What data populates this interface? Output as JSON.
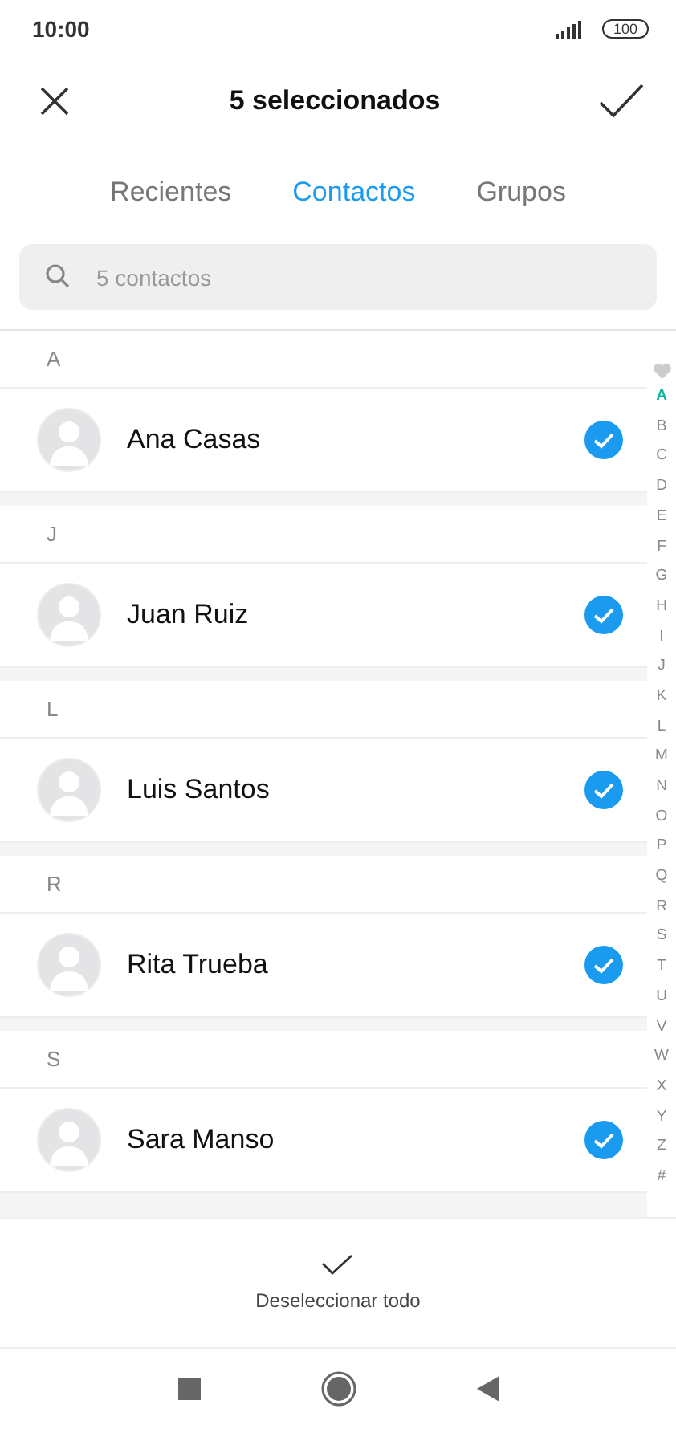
{
  "status_bar": {
    "time": "10:00",
    "battery": "100"
  },
  "header": {
    "title": "5 seleccionados"
  },
  "tabs": [
    {
      "label": "Recientes",
      "selected": false
    },
    {
      "label": "Contactos",
      "selected": true
    },
    {
      "label": "Grupos",
      "selected": false
    }
  ],
  "search": {
    "placeholder": "5 contactos"
  },
  "groups": [
    {
      "letter": "A",
      "contacts": [
        {
          "name": "Ana Casas",
          "checked": true
        }
      ]
    },
    {
      "letter": "J",
      "contacts": [
        {
          "name": "Juan Ruiz",
          "checked": true
        }
      ]
    },
    {
      "letter": "L",
      "contacts": [
        {
          "name": "Luis Santos",
          "checked": true
        }
      ]
    },
    {
      "letter": "R",
      "contacts": [
        {
          "name": "Rita Trueba",
          "checked": true
        }
      ]
    },
    {
      "letter": "S",
      "contacts": [
        {
          "name": "Sara Manso",
          "checked": true
        }
      ]
    }
  ],
  "index": [
    {
      "label": "A",
      "selected": true
    },
    {
      "label": "B",
      "selected": false
    },
    {
      "label": "C",
      "selected": false
    },
    {
      "label": "D",
      "selected": false
    },
    {
      "label": "E",
      "selected": false
    },
    {
      "label": "F",
      "selected": false
    },
    {
      "label": "G",
      "selected": false
    },
    {
      "label": "H",
      "selected": false
    },
    {
      "label": "I",
      "selected": false
    },
    {
      "label": "J",
      "selected": false
    },
    {
      "label": "K",
      "selected": false
    },
    {
      "label": "L",
      "selected": false
    },
    {
      "label": "M",
      "selected": false
    },
    {
      "label": "N",
      "selected": false
    },
    {
      "label": "O",
      "selected": false
    },
    {
      "label": "P",
      "selected": false
    },
    {
      "label": "Q",
      "selected": false
    },
    {
      "label": "R",
      "selected": false
    },
    {
      "label": "S",
      "selected": false
    },
    {
      "label": "T",
      "selected": false
    },
    {
      "label": "U",
      "selected": false
    },
    {
      "label": "V",
      "selected": false
    },
    {
      "label": "W",
      "selected": false
    },
    {
      "label": "X",
      "selected": false
    },
    {
      "label": "Y",
      "selected": false
    },
    {
      "label": "Z",
      "selected": false
    },
    {
      "label": "#",
      "selected": false
    }
  ],
  "bottom_action": {
    "label": "Deseleccionar todo"
  }
}
